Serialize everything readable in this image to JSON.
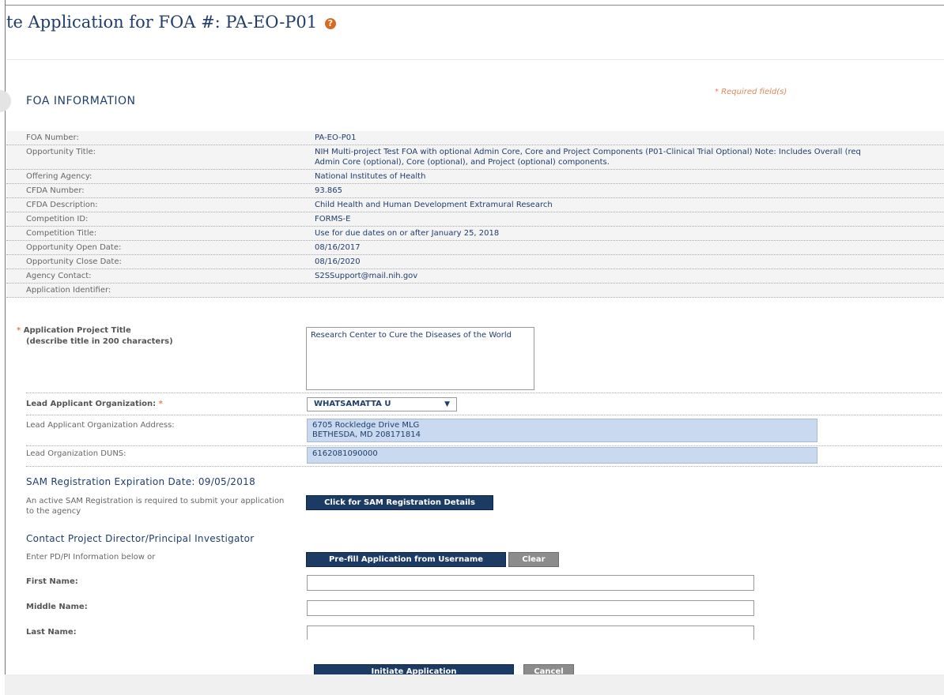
{
  "page": {
    "title": "te Application for FOA #: PA-EO-P01",
    "help_icon": "?"
  },
  "section": {
    "title": "FOA INFORMATION",
    "required_note": "* Required field(s)"
  },
  "foa_info": [
    {
      "label": "FOA Number:",
      "value": "PA-EO-P01"
    },
    {
      "label": "Opportunity Title:",
      "value": "NIH Multi-project Test FOA with optional Admin Core, Core and Project Components (P01-Clinical Trial Optional) Note: Includes Overall (req",
      "value2": "Admin Core (optional), Core (optional), and Project (optional) components."
    },
    {
      "label": "Offering Agency:",
      "value": "National Institutes of Health"
    },
    {
      "label": "CFDA Number:",
      "value": "93.865"
    },
    {
      "label": "CFDA Description:",
      "value": "Child Health and Human Development Extramural Research"
    },
    {
      "label": "Competition ID:",
      "value": "FORMS-E"
    },
    {
      "label": "Competition Title:",
      "value": "Use for due dates on or after January 25, 2018"
    },
    {
      "label": "Opportunity Open Date:",
      "value": "08/16/2017"
    },
    {
      "label": "Opportunity Close Date:",
      "value": "08/16/2020"
    },
    {
      "label": "Agency Contact:",
      "value": "S2SSupport@mail.nih.gov"
    },
    {
      "label": "Application Identifier:",
      "value": ""
    }
  ],
  "form": {
    "project_title_label": "Application Project Title",
    "project_title_hint": "(describe title in 200 characters)",
    "project_title_value": "Research Center to Cure the Diseases of the World",
    "lead_org_label": "Lead Applicant Organization:",
    "lead_org_value": "WHATSAMATTA U",
    "lead_org_address_label": "Lead Applicant Organization Address:",
    "lead_org_address_value": "6705 Rockledge Drive MLG\nBETHESDA, MD 208171814",
    "duns_label": "Lead Organization DUNS:",
    "duns_value": "6162081090000",
    "required_star": "*"
  },
  "sam": {
    "heading": "SAM Registration Expiration Date: 09/05/2018",
    "note": "An active SAM Registration is required to submit your application to the agency",
    "button": "Click for SAM Registration Details"
  },
  "pdpi": {
    "heading": "Contact Project Director/Principal Investigator",
    "prompt": "Enter PD/PI Information below or",
    "prefill_button": "Pre-fill Application from Username",
    "clear_button": "Clear",
    "first_name_label": "First Name:",
    "middle_name_label": "Middle Name:",
    "last_name_label": "Last Name:"
  },
  "actions": {
    "initiate": "Initiate Application",
    "cancel": "Cancel"
  },
  "colors": {
    "primary": "#1b3a64",
    "required": "#e0865a",
    "readonly_bg": "#c9daf0"
  }
}
